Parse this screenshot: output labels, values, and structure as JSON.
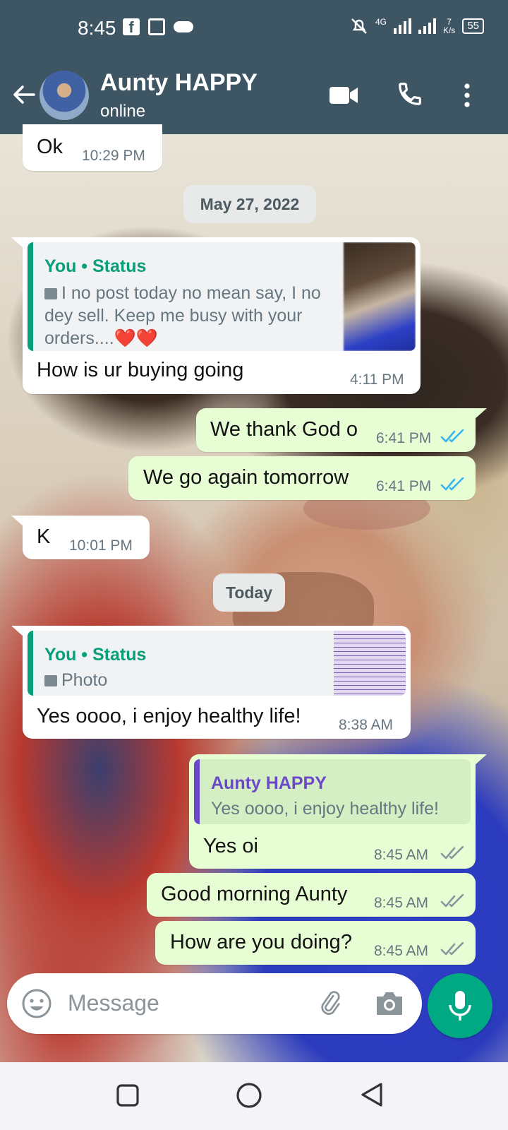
{
  "status_bar": {
    "time": "8:45",
    "network": "4G",
    "speed_value": "7",
    "speed_unit": "K/s",
    "battery": "55"
  },
  "header": {
    "contact_name": "Aunty HAPPY",
    "contact_status": "online"
  },
  "messages": [
    {
      "text": "Ok",
      "time": "10:29 PM"
    },
    {
      "date_chip": "May 27, 2022"
    },
    {
      "quote_title": "You • Status",
      "quote_text": "I no post today no mean say, I no dey sell. Keep me busy with your orders....❤️❤️",
      "text": "How is ur buying going",
      "time": "4:11 PM"
    },
    {
      "text": "We thank God o",
      "time": "6:41 PM"
    },
    {
      "text": "We go again tomorrow",
      "time": "6:41 PM"
    },
    {
      "text": "K",
      "time": "10:01 PM"
    },
    {
      "date_chip": "Today"
    },
    {
      "quote_title": "You • Status",
      "quote_text": "Photo",
      "text": "Yes oooo, i enjoy healthy life!",
      "time": "8:38 AM"
    },
    {
      "quote_title": "Aunty HAPPY",
      "quote_text": "Yes oooo, i enjoy healthy life!",
      "text": "Yes oi",
      "time": "8:45 AM"
    },
    {
      "text": "Good morning Aunty",
      "time": "8:45 AM"
    },
    {
      "text": "How are you doing?",
      "time": "8:45 AM"
    }
  ],
  "input": {
    "placeholder": "Message"
  },
  "icons": {
    "back": "arrow-left-icon",
    "video": "video-call-icon",
    "call": "phone-icon",
    "menu": "more-vert-icon",
    "emoji": "emoji-icon",
    "attach": "paperclip-icon",
    "camera": "camera-icon",
    "mic": "microphone-icon"
  },
  "colors": {
    "header": "#3e5563",
    "outgoing_bubble": "#e7fdd4",
    "incoming_bubble": "#ffffff",
    "accent": "#00a884",
    "read_tick": "#34b7f1",
    "sent_tick": "#8696a0"
  }
}
